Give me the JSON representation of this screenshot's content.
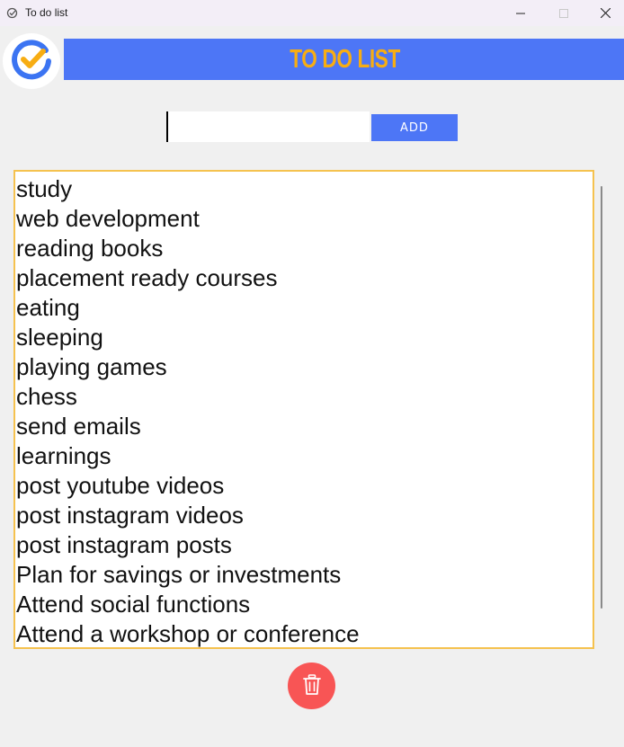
{
  "window": {
    "title": "To do list",
    "icon": "todo-check-icon"
  },
  "header": {
    "title": "TO DO LIST",
    "logo_icon": "checkmark-circle-icon",
    "colors": {
      "bar": "#4d76f6",
      "title": "#f7ad13"
    }
  },
  "input": {
    "value": "",
    "placeholder": ""
  },
  "add_button": {
    "label": "ADD"
  },
  "tasks": [
    "study",
    "web development",
    "reading books",
    "placement ready courses",
    "eating",
    "sleeping",
    "playing games",
    "chess",
    "send emails",
    "learnings",
    "post youtube videos",
    "post instagram videos",
    "post instagram posts",
    "Plan for savings or investments",
    "Attend social functions",
    "Attend a workshop or conference"
  ],
  "delete_button": {
    "icon": "trash-icon",
    "color": "#f85555"
  }
}
